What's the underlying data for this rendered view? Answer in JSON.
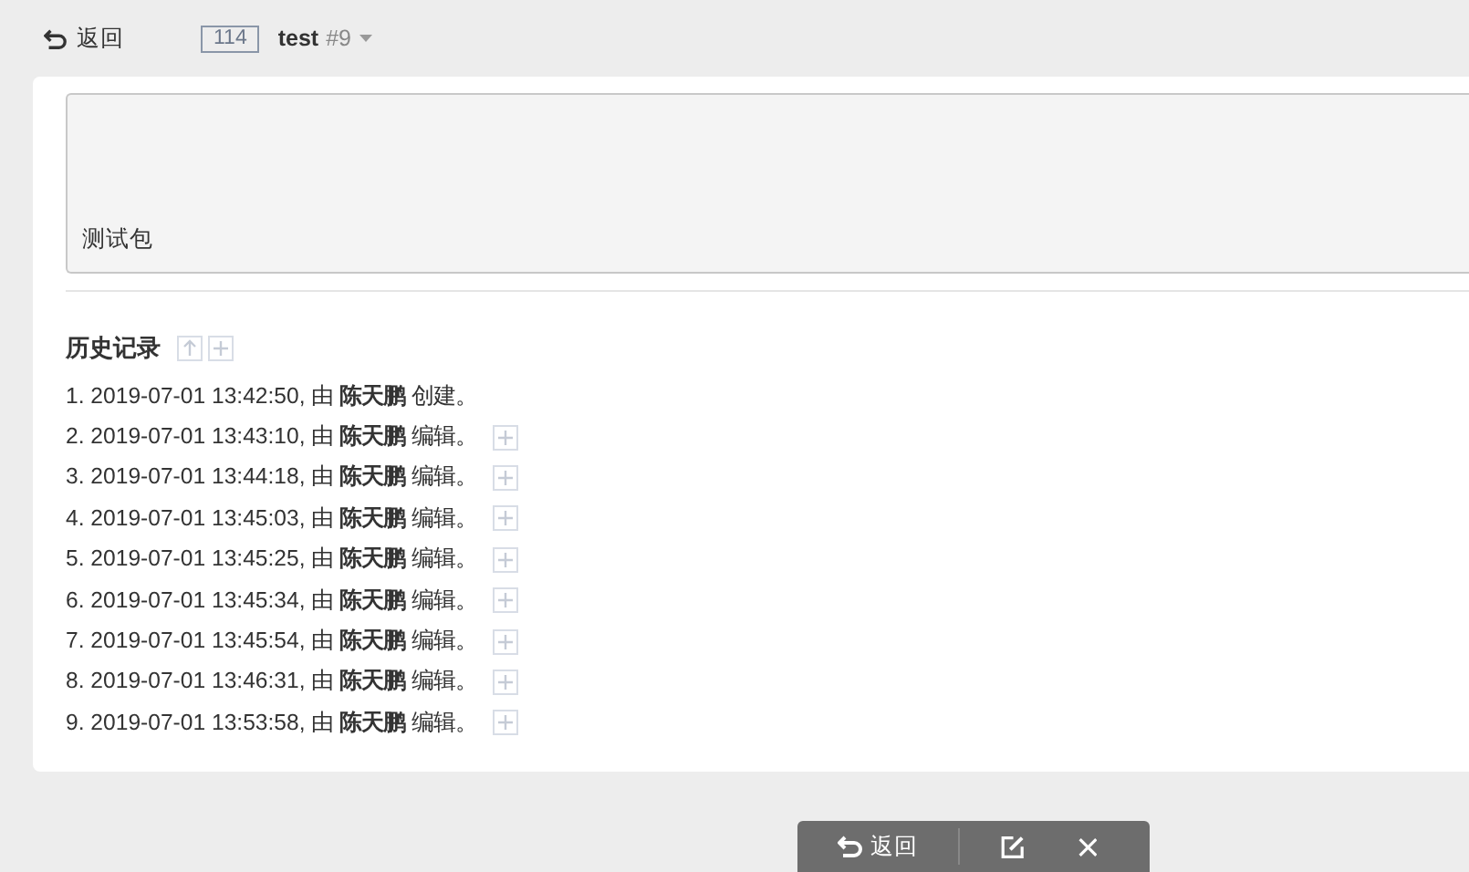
{
  "header": {
    "back_label": "返回",
    "id_badge": "114",
    "title": "test",
    "number": "#9"
  },
  "description": {
    "value": "测试包"
  },
  "history": {
    "title": "历史记录",
    "entries": [
      {
        "text": "1. 2019-07-01 13:42:50, 由 **陈天鹏** 创建。",
        "expandable": false
      },
      {
        "text": "2. 2019-07-01 13:43:10, 由 **陈天鹏** 编辑。",
        "expandable": true
      },
      {
        "text": "3. 2019-07-01 13:44:18, 由 **陈天鹏** 编辑。",
        "expandable": true
      },
      {
        "text": "4. 2019-07-01 13:45:03, 由 **陈天鹏** 编辑。",
        "expandable": true
      },
      {
        "text": "5. 2019-07-01 13:45:25, 由 **陈天鹏** 编辑。",
        "expandable": true
      },
      {
        "text": "6. 2019-07-01 13:45:34, 由 **陈天鹏** 编辑。",
        "expandable": true
      },
      {
        "text": "7. 2019-07-01 13:45:54, 由 **陈天鹏** 编辑。",
        "expandable": true
      },
      {
        "text": "8. 2019-07-01 13:46:31, 由 **陈天鹏** 编辑。",
        "expandable": true
      },
      {
        "text": "9. 2019-07-01 13:53:58, 由 **陈天鹏** 编辑。",
        "expandable": true
      }
    ]
  },
  "toolbar": {
    "back_label": "返回"
  }
}
